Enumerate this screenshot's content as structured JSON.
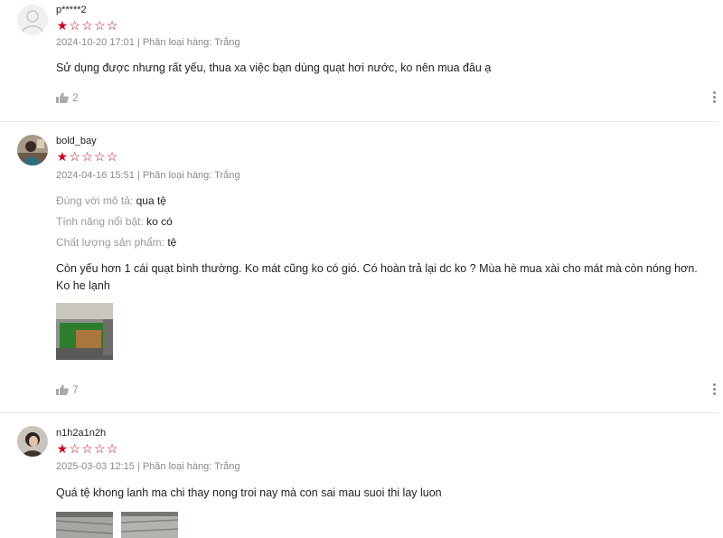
{
  "reviews": [
    {
      "username": "p*****2",
      "rating": 1,
      "max_rating": 5,
      "timestamp": "2024-10-20 17:01",
      "variant": "Phân loại hàng: Trắng",
      "attributes": [],
      "text": "Sử dụng được nhưng rất yếu, thua xa việc bạn dùng quạt hơi nước, ko nên mua đâu ạ",
      "likes": "2",
      "avatar_icon": "default-user-icon"
    },
    {
      "username": "bold_bay",
      "rating": 1,
      "max_rating": 5,
      "timestamp": "2024-04-16 15:51",
      "variant": "Phân loại hàng: Trắng",
      "attributes": [
        {
          "label": "Đúng với mô tả:",
          "value": "qua tệ"
        },
        {
          "label": "Tính năng nổi bật:",
          "value": "ko có"
        },
        {
          "label": "Chất lượng sản phẩm:",
          "value": "tệ"
        }
      ],
      "text": "Còn yếu hơn 1 cái quạt bình thường. Ko mát cũng ko có gió. Có hoàn trả lại dc ko ? Mùa hè mua xài cho mát mà còn nóng hơn. Ko he lạnh",
      "likes": "7",
      "avatar_icon": "user-photo-icon"
    },
    {
      "username": "n1h2a1n2h",
      "rating": 1,
      "max_rating": 5,
      "timestamp": "2025-03-03 12:15",
      "variant": "Phân loại hàng: Trắng",
      "attributes": [],
      "text": "Quá tệ khong lanh ma chi thay nong troi nay mà con sai mau suoi thi lay luon",
      "likes": "",
      "avatar_icon": "user-photo-icon"
    }
  ],
  "colors": {
    "star": "#d0011b",
    "muted": "#888888",
    "divider": "#e8e8e8"
  },
  "icons": {
    "like": "thumbs-up-icon",
    "more": "more-vertical-icon",
    "star_filled": "star-filled-icon",
    "star_empty": "star-outline-icon"
  }
}
